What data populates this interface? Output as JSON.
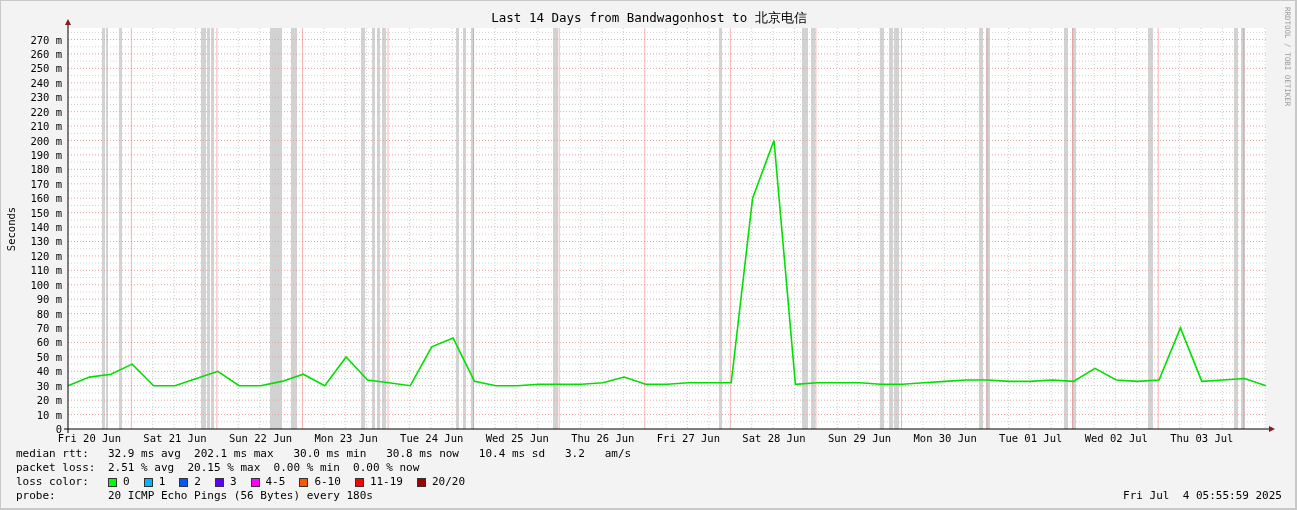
{
  "graph": {
    "credit": "RRDTOOL / TOBI OETIKER",
    "chart_data": {
      "type": "line",
      "grid": true,
      "title": "Last 14 Days from Bandwagonhost to 北京电信",
      "ylabel": "Seconds",
      "ylim": [
        0,
        278
      ],
      "categories": [
        null,
        "Fri 20 Jun",
        null,
        null,
        null,
        "Sat 21 Jun",
        null,
        null,
        null,
        "Sun 22 Jun",
        null,
        null,
        null,
        "Mon 23 Jun",
        null,
        null,
        null,
        "Tue 24 Jun",
        null,
        null,
        null,
        "Wed 25 Jun",
        null,
        null,
        null,
        "Thu 26 Jun",
        null,
        null,
        null,
        "Fri 27 Jun",
        null,
        null,
        null,
        "Sat 28 Jun",
        null,
        null,
        null,
        "Sun 29 Jun",
        null,
        null,
        null,
        "Mon 30 Jun",
        null,
        null,
        null,
        "Tue 01 Jul",
        null,
        null,
        null,
        "Wed 02 Jul",
        null,
        null,
        null,
        "Thu 03 Jul",
        null,
        null,
        null
      ],
      "series": [
        {
          "color": "#00e000",
          "values": [
            30,
            36,
            38,
            45,
            30,
            30,
            35,
            40,
            30,
            30,
            33,
            38,
            30,
            50,
            34,
            32,
            30,
            57,
            63,
            33,
            30,
            30,
            31,
            31,
            31,
            32,
            36,
            31,
            31,
            32,
            32,
            32,
            160,
            200,
            31,
            32,
            32,
            32,
            31,
            31,
            32,
            33,
            34,
            34,
            33,
            33,
            34,
            33,
            42,
            34,
            33,
            34,
            70,
            33,
            34,
            35,
            30
          ]
        }
      ],
      "yticks": [
        {
          "value": 0,
          "label": "0"
        },
        {
          "value": 10,
          "label": "10 m"
        },
        {
          "value": 20,
          "label": "20 m"
        },
        {
          "value": 30,
          "label": "30 m"
        },
        {
          "value": 40,
          "label": "40 m"
        },
        {
          "value": 50,
          "label": "50 m"
        },
        {
          "value": 60,
          "label": "60 m"
        },
        {
          "value": 70,
          "label": "70 m"
        },
        {
          "value": 80,
          "label": "80 m"
        },
        {
          "value": 90,
          "label": "90 m"
        },
        {
          "value": 100,
          "label": "100 m"
        },
        {
          "value": 110,
          "label": "110 m"
        },
        {
          "value": 120,
          "label": "120 m"
        },
        {
          "value": 130,
          "label": "130 m"
        },
        {
          "value": 140,
          "label": "140 m"
        },
        {
          "value": 150,
          "label": "150 m"
        },
        {
          "value": 160,
          "label": "160 m"
        },
        {
          "value": 170,
          "label": "170 m"
        },
        {
          "value": 180,
          "label": "180 m"
        },
        {
          "value": 190,
          "label": "190 m"
        },
        {
          "value": 200,
          "label": "200 m"
        },
        {
          "value": 210,
          "label": "210 m"
        },
        {
          "value": 220,
          "label": "220 m"
        },
        {
          "value": 230,
          "label": "230 m"
        },
        {
          "value": 240,
          "label": "240 m"
        },
        {
          "value": 250,
          "label": "250 m"
        },
        {
          "value": 260,
          "label": "260 m"
        },
        {
          "value": 270,
          "label": "270 m"
        }
      ]
    }
  },
  "legend": {
    "median_rtt": {
      "label": "median rtt:",
      "text": "32.9 ms avg  202.1 ms max   30.0 ms min   30.8 ms now   10.4 ms sd   3.2   am/s"
    },
    "packet_loss": {
      "label": "packet loss:",
      "text": "2.51 % avg  20.15 % max  0.00 % min  0.00 % now"
    },
    "loss_color": {
      "label": "loss color:",
      "items": [
        {
          "label": "0",
          "color": "#00ff00"
        },
        {
          "label": "1",
          "color": "#00b8ff"
        },
        {
          "label": "2",
          "color": "#0059ff"
        },
        {
          "label": "3",
          "color": "#5e00ff"
        },
        {
          "label": "4-5",
          "color": "#ff00ff"
        },
        {
          "label": "6-10",
          "color": "#ff5500"
        },
        {
          "label": "11-19",
          "color": "#ff0000"
        },
        {
          "label": "20/20",
          "color": "#a10000"
        }
      ]
    },
    "probe": {
      "label": "probe:",
      "text": "20 ICMP Echo Pings (56 Bytes) every 180s"
    },
    "timestamp": "Fri Jul  4 05:55:59 2025"
  }
}
